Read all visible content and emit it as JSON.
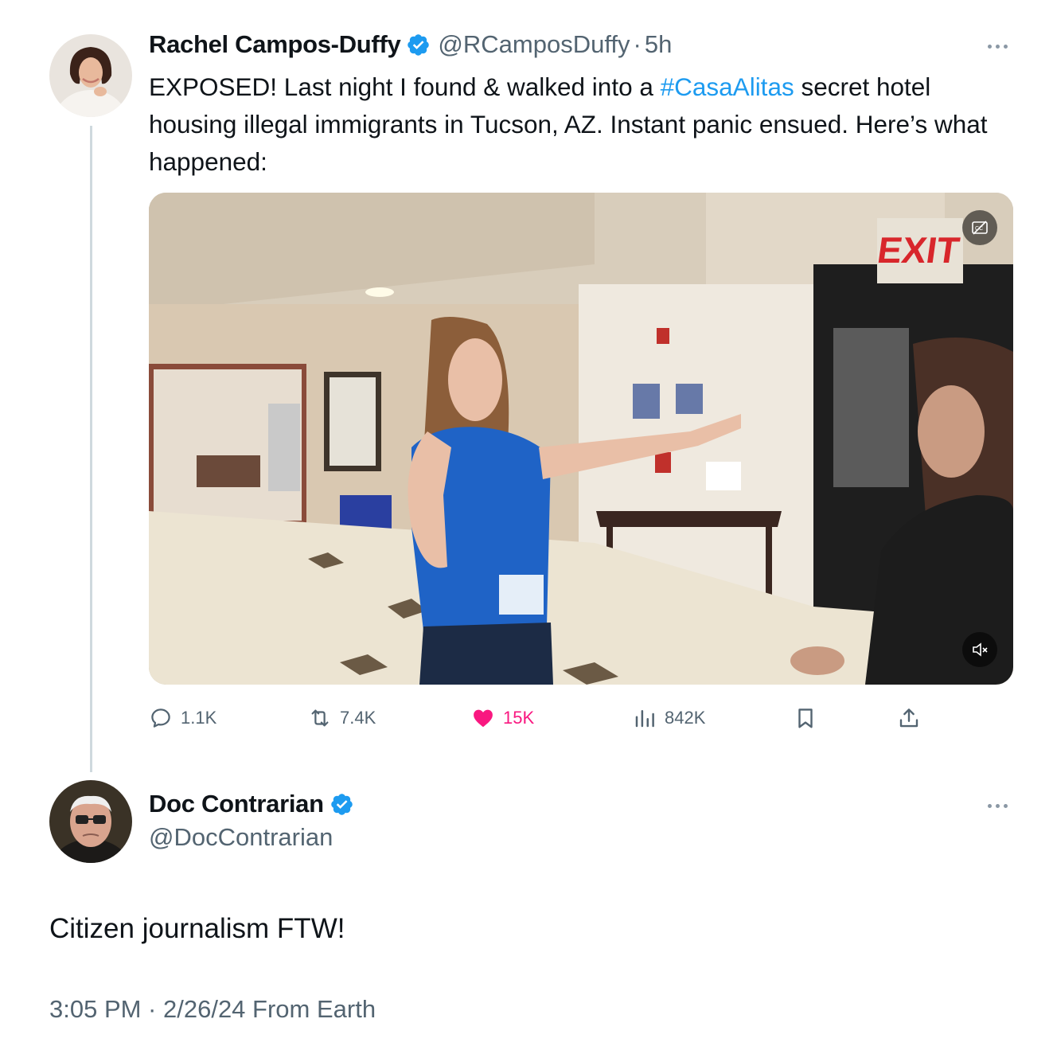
{
  "original_tweet": {
    "author": {
      "name": "Rachel Campos-Duffy",
      "handle": "@RCamposDuffy",
      "verified": true,
      "avatar_icon": "profile-photo-woman"
    },
    "timestamp": "5h",
    "text_parts": {
      "before_hashtag": "EXPOSED! Last night I found & walked into a ",
      "hashtag": "#CasaAlitas",
      "after_hashtag": " secret hotel housing illegal immigrants in Tucson, AZ. Instant panic ensued. Here’s what happened:"
    },
    "media": {
      "type": "video",
      "overlay_text": "EXIT",
      "captions_icon": "closed-captions-off-icon",
      "mute_icon": "speaker-muted-icon"
    },
    "stats": {
      "replies": "1.1K",
      "reposts": "7.4K",
      "likes": "15K",
      "views": "842K"
    },
    "colors": {
      "hashtag": "#1d9bf0",
      "like": "#f91880",
      "secondary": "#536471",
      "verified": "#1d9bf0"
    }
  },
  "reply_tweet": {
    "author": {
      "name": "Doc Contrarian",
      "handle": "@DocContrarian",
      "verified": true,
      "avatar_icon": "profile-photo-old-man-glasses"
    },
    "text": "Citizen journalism FTW!",
    "meta": "3:05 PM · 2/26/24 From Earth"
  }
}
